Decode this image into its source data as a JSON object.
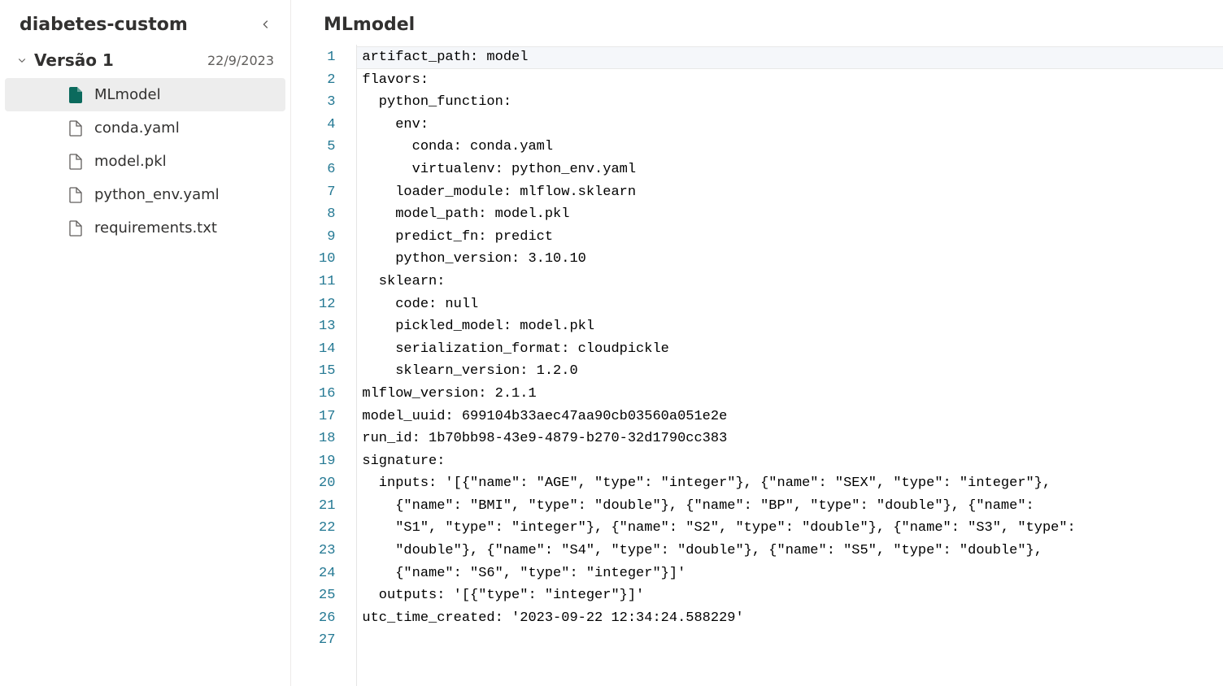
{
  "sidebar": {
    "title": "diabetes-custom",
    "version_label": "Versão 1",
    "version_date": "22/9/2023",
    "files": [
      {
        "name": "MLmodel",
        "active": true,
        "icon": "file-filled"
      },
      {
        "name": "conda.yaml",
        "active": false,
        "icon": "file-outline"
      },
      {
        "name": "model.pkl",
        "active": false,
        "icon": "file-outline"
      },
      {
        "name": "python_env.yaml",
        "active": false,
        "icon": "file-outline"
      },
      {
        "name": "requirements.txt",
        "active": false,
        "icon": "file-outline"
      }
    ]
  },
  "main": {
    "title": "MLmodel"
  },
  "editor": {
    "lines": [
      "artifact_path: model",
      "flavors:",
      "  python_function:",
      "    env:",
      "      conda: conda.yaml",
      "      virtualenv: python_env.yaml",
      "    loader_module: mlflow.sklearn",
      "    model_path: model.pkl",
      "    predict_fn: predict",
      "    python_version: 3.10.10",
      "  sklearn:",
      "    code: null",
      "    pickled_model: model.pkl",
      "    serialization_format: cloudpickle",
      "    sklearn_version: 1.2.0",
      "mlflow_version: 2.1.1",
      "model_uuid: 699104b33aec47aa90cb03560a051e2e",
      "run_id: 1b70bb98-43e9-4879-b270-32d1790cc383",
      "signature:",
      "  inputs: '[{\"name\": \"AGE\", \"type\": \"integer\"}, {\"name\": \"SEX\", \"type\": \"integer\"},",
      "    {\"name\": \"BMI\", \"type\": \"double\"}, {\"name\": \"BP\", \"type\": \"double\"}, {\"name\":",
      "    \"S1\", \"type\": \"integer\"}, {\"name\": \"S2\", \"type\": \"double\"}, {\"name\": \"S3\", \"type\":",
      "    \"double\"}, {\"name\": \"S4\", \"type\": \"double\"}, {\"name\": \"S5\", \"type\": \"double\"},",
      "    {\"name\": \"S6\", \"type\": \"integer\"}]'",
      "  outputs: '[{\"type\": \"integer\"}]'",
      "utc_time_created: '2023-09-22 12:34:24.588229'",
      ""
    ],
    "current_line_index": 0
  }
}
